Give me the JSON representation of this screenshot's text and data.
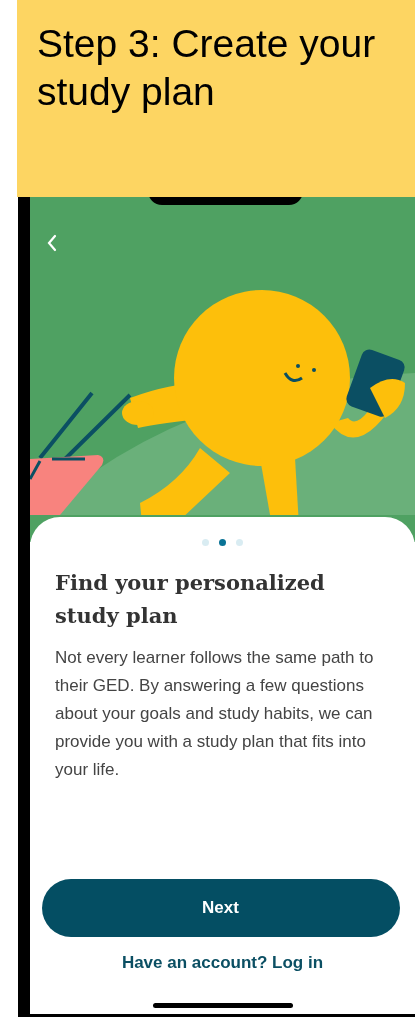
{
  "slide_title": "Step 3: Create your study plan",
  "pagination": [
    {
      "selected": false
    },
    {
      "selected": true
    },
    {
      "selected": false
    }
  ],
  "heading": "Find your personalized study plan",
  "body": "Not every learner follows the same path to their GED. By answering a few questions about your goals and study habits, we can provide you with a study plan that fits into your life.",
  "primary_button": "Next",
  "login_link": "Have an account? Log in"
}
